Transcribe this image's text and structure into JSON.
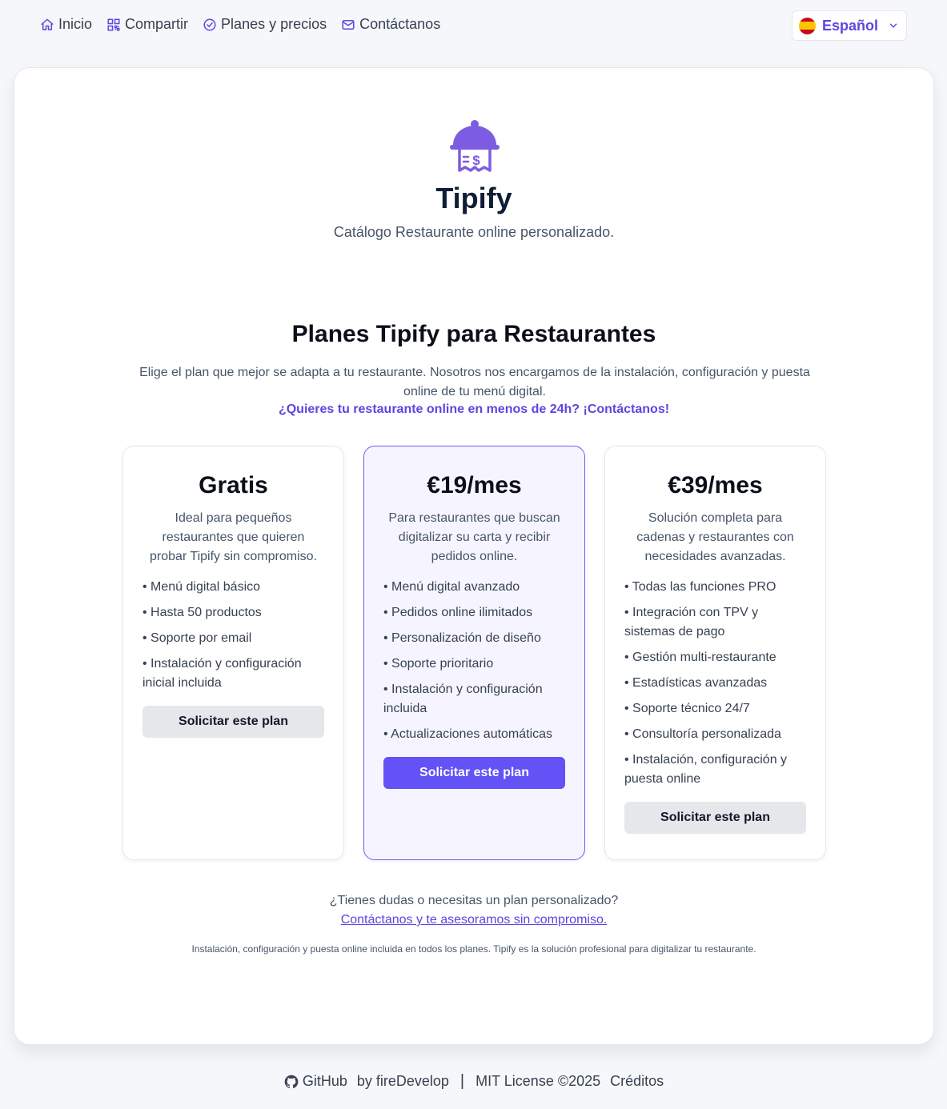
{
  "nav": {
    "items": [
      {
        "label": "Inicio",
        "icon": "home-icon"
      },
      {
        "label": "Compartir",
        "icon": "qr-code-icon"
      },
      {
        "label": "Planes y precios",
        "icon": "check-circle-icon"
      },
      {
        "label": "Contáctanos",
        "icon": "mail-icon"
      }
    ],
    "language": {
      "label": "Español",
      "icon": "spain-flag-icon"
    }
  },
  "brand": {
    "title": "Tipify",
    "tagline": "Catálogo Restaurante online personalizado.",
    "accent_color": "#6352f5"
  },
  "plans_section": {
    "title": "Planes Tipify para Restaurantes",
    "description": "Elige el plan que mejor se adapta a tu restaurante. Nosotros nos encargamos de la instalación, configuración y puesta online de tu menú digital.",
    "cta": "¿Quieres tu restaurante online en menos de 24h? ¡Contáctanos!",
    "plans": [
      {
        "price": "Gratis",
        "description": "Ideal para pequeños restaurantes que quieren probar Tipify sin compromiso.",
        "features": [
          "Menú digital básico",
          "Hasta 50 productos",
          "Soporte por email",
          "Instalación y configuración inicial incluida"
        ],
        "button": "Solicitar este plan"
      },
      {
        "price": "€19/mes",
        "description": "Para restaurantes que buscan digitalizar su carta y recibir pedidos online.",
        "features": [
          "Menú digital avanzado",
          "Pedidos online ilimitados",
          "Personalización de diseño",
          "Soporte prioritario",
          "Instalación y configuración incluida",
          "Actualizaciones automáticas"
        ],
        "button": "Solicitar este plan"
      },
      {
        "price": "€39/mes",
        "description": "Solución completa para cadenas y restaurantes con necesidades avanzadas.",
        "features": [
          "Todas las funciones PRO",
          "Integración con TPV y sistemas de pago",
          "Gestión multi-restaurante",
          "Estadísticas avanzadas",
          "Soporte técnico 24/7",
          "Consultoría personalizada",
          "Instalación, configuración y puesta online"
        ],
        "button": "Solicitar este plan"
      }
    ],
    "help_question": "¿Tienes dudas o necesitas un plan personalizado?",
    "help_link": "Contáctanos y te asesoramos sin compromiso.",
    "note": "Instalación, configuración y puesta online incluida en todos los planes. Tipify es la solución profesional para digitalizar tu restaurante."
  },
  "footer": {
    "github": "GitHub",
    "by": "by fireDevelop",
    "separator": "|",
    "license": "MIT License ©2025",
    "credits": "Créditos"
  }
}
